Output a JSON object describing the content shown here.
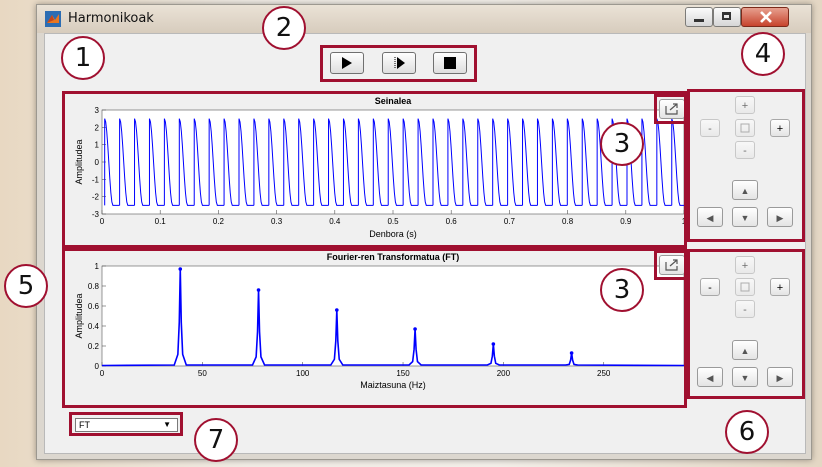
{
  "window": {
    "title": "Harmonikoak"
  },
  "toolbar": {
    "play_icon": "play-icon",
    "step_icon": "step-icon",
    "stop_icon": "stop-icon"
  },
  "callouts": [
    "1",
    "2",
    "3",
    "4",
    "5",
    "3",
    "6",
    "7"
  ],
  "signal_plot": {
    "title": "Seinalea",
    "xlabel": "Denbora (s)",
    "ylabel": "Amplitudea",
    "x_ticks": [
      "0",
      "0.1",
      "0.2",
      "0.3",
      "0.4",
      "0.5",
      "0.6",
      "0.7",
      "0.8",
      "0.9",
      "1"
    ],
    "y_ticks": [
      "3",
      "2",
      "1",
      "0",
      "-1",
      "-2",
      "-3"
    ]
  },
  "ft_plot": {
    "title": "Fourier-ren Transformatua (FT)",
    "xlabel": "Maiztasuna (Hz)",
    "ylabel": "Amplitudea",
    "x_ticks": [
      "0",
      "50",
      "100",
      "150",
      "200",
      "250"
    ],
    "y_ticks": [
      "1",
      "0.8",
      "0.6",
      "0.4",
      "0.2",
      "0"
    ]
  },
  "nav_panel": {
    "zoom_in": "+",
    "zoom_out": "-",
    "up": "▲",
    "down": "▼",
    "left": "◀",
    "right": "▶"
  },
  "selector": {
    "value": "FT",
    "arrow": "▼"
  },
  "chart_data": [
    {
      "type": "line",
      "title": "Seinalea",
      "xlabel": "Denbora (s)",
      "ylabel": "Amplitudea",
      "xlim": [
        0,
        1
      ],
      "ylim": [
        -3,
        3
      ],
      "color": "#0000ff",
      "description_values": {
        "periods": 39,
        "peak": 2.5,
        "trough": -2.5
      }
    },
    {
      "type": "line",
      "title": "Fourier-ren Transformatua (FT)",
      "xlabel": "Maiztasuna (Hz)",
      "ylabel": "Amplitudea",
      "xlim": [
        0,
        290
      ],
      "ylim": [
        0,
        1
      ],
      "color": "#0000ff",
      "x": [
        39,
        78,
        117,
        156,
        195,
        234
      ],
      "values": [
        0.97,
        0.76,
        0.56,
        0.37,
        0.22,
        0.13
      ]
    }
  ]
}
